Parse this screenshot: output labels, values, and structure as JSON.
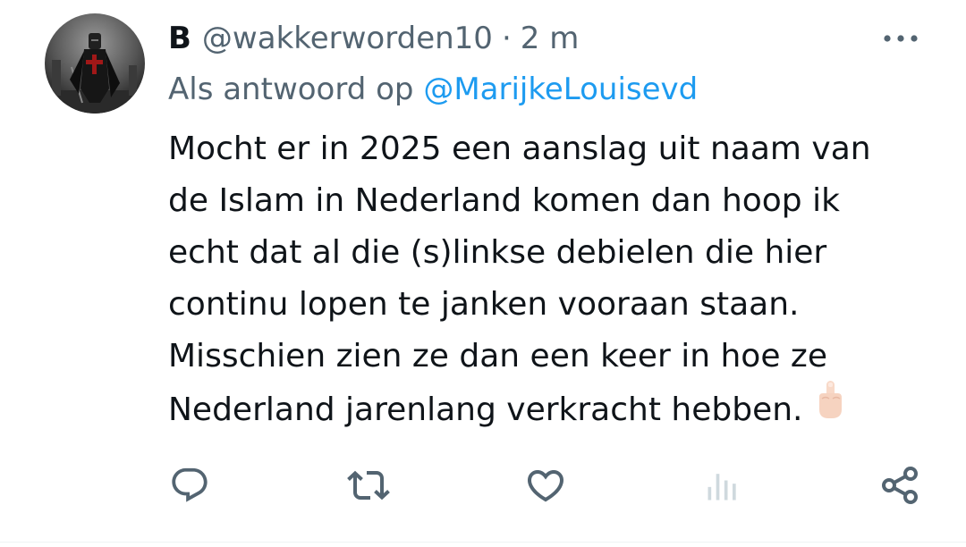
{
  "tweet": {
    "display_name": "B",
    "handle": "@wakkerworden10",
    "separator": "·",
    "time": "2 m",
    "reply_prefix": "Als antwoord op",
    "reply_mention": "@MarijkeLouisevd",
    "text_lines": [
      "Mocht er in 2025 een aanslag uit naam van",
      "de Islam in Nederland komen dan hoop ik",
      "echt dat al die (s)linkse debielen die hier",
      "continu lopen te janken vooraan staan.",
      "Misschien zien ze dan een keer in hoe ze",
      "Nederland jarenlang verkracht hebben."
    ],
    "emoji": "middle-finger"
  },
  "actions": [
    "reply-icon",
    "retweet-icon",
    "like-icon",
    "views-icon",
    "share-icon"
  ],
  "colors": {
    "text": "#0f1419",
    "secondary": "#536471",
    "link": "#1d9bf0",
    "views_icon": "#cfd9de"
  }
}
